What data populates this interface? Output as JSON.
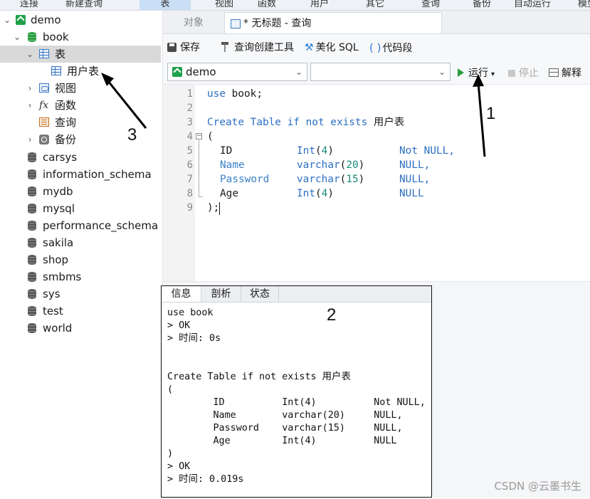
{
  "top_toolbar": [
    "连接",
    "新建查询",
    "表",
    "视图",
    "函数",
    "用户",
    "其它",
    "查询",
    "备份",
    "自动运行",
    "模型"
  ],
  "sidebar": {
    "connection": "demo",
    "database": "book",
    "tables_node": "表",
    "table_item": "用户表",
    "views_node": "视图",
    "functions_node": "函数",
    "queries_node": "查询",
    "backups_node": "备份",
    "databases": [
      "carsys",
      "information_schema",
      "mydb",
      "mysql",
      "performance_schema",
      "sakila",
      "shop",
      "smbms",
      "sys",
      "test",
      "world"
    ]
  },
  "tabs": {
    "objects": "对象",
    "query_tab": "* 无标题 - 查询"
  },
  "toolbar": {
    "save": "保存",
    "query_builder": "查询创建工具",
    "beautify": "美化 SQL",
    "snippet": "代码段"
  },
  "run_bar": {
    "connection_select": "demo",
    "database_select": "",
    "run": "运行",
    "stop": "停止",
    "explain": "解释"
  },
  "editor": {
    "line_numbers": [
      "1",
      "2",
      "3",
      "4",
      "5",
      "6",
      "7",
      "8",
      "9"
    ],
    "line1_kw": "use",
    "line1_rest": " book;",
    "line3_kw": "Create Table if not exists",
    "line3_rest": " 用户表",
    "line4": "(",
    "columns": [
      {
        "name": "ID",
        "type": "Int",
        "len": "4",
        "null": "Not NULL,"
      },
      {
        "name": "Name",
        "type": "varchar",
        "len": "20",
        "null": "NULL,"
      },
      {
        "name": "Password",
        "type": "varchar",
        "len": "15",
        "null": "NULL,"
      },
      {
        "name": "Age",
        "type": "Int",
        "len": "4",
        "null": "NULL"
      }
    ],
    "line9": ");"
  },
  "result_tabs": [
    "信息",
    "剖析",
    "状态"
  ],
  "messages": [
    "use book",
    "> OK",
    "> 时间: 0s",
    "",
    "",
    "Create Table if not exists 用户表",
    "(",
    "        ID          Int(4)          Not NULL,",
    "        Name        varchar(20)     NULL,",
    "        Password    varchar(15)     NULL,",
    "        Age         Int(4)          NULL",
    ")",
    "> OK",
    "> 时间: 0.019s"
  ],
  "callouts": {
    "one": "1",
    "two": "2",
    "three": "3"
  },
  "watermark": "CSDN @云墨书生"
}
